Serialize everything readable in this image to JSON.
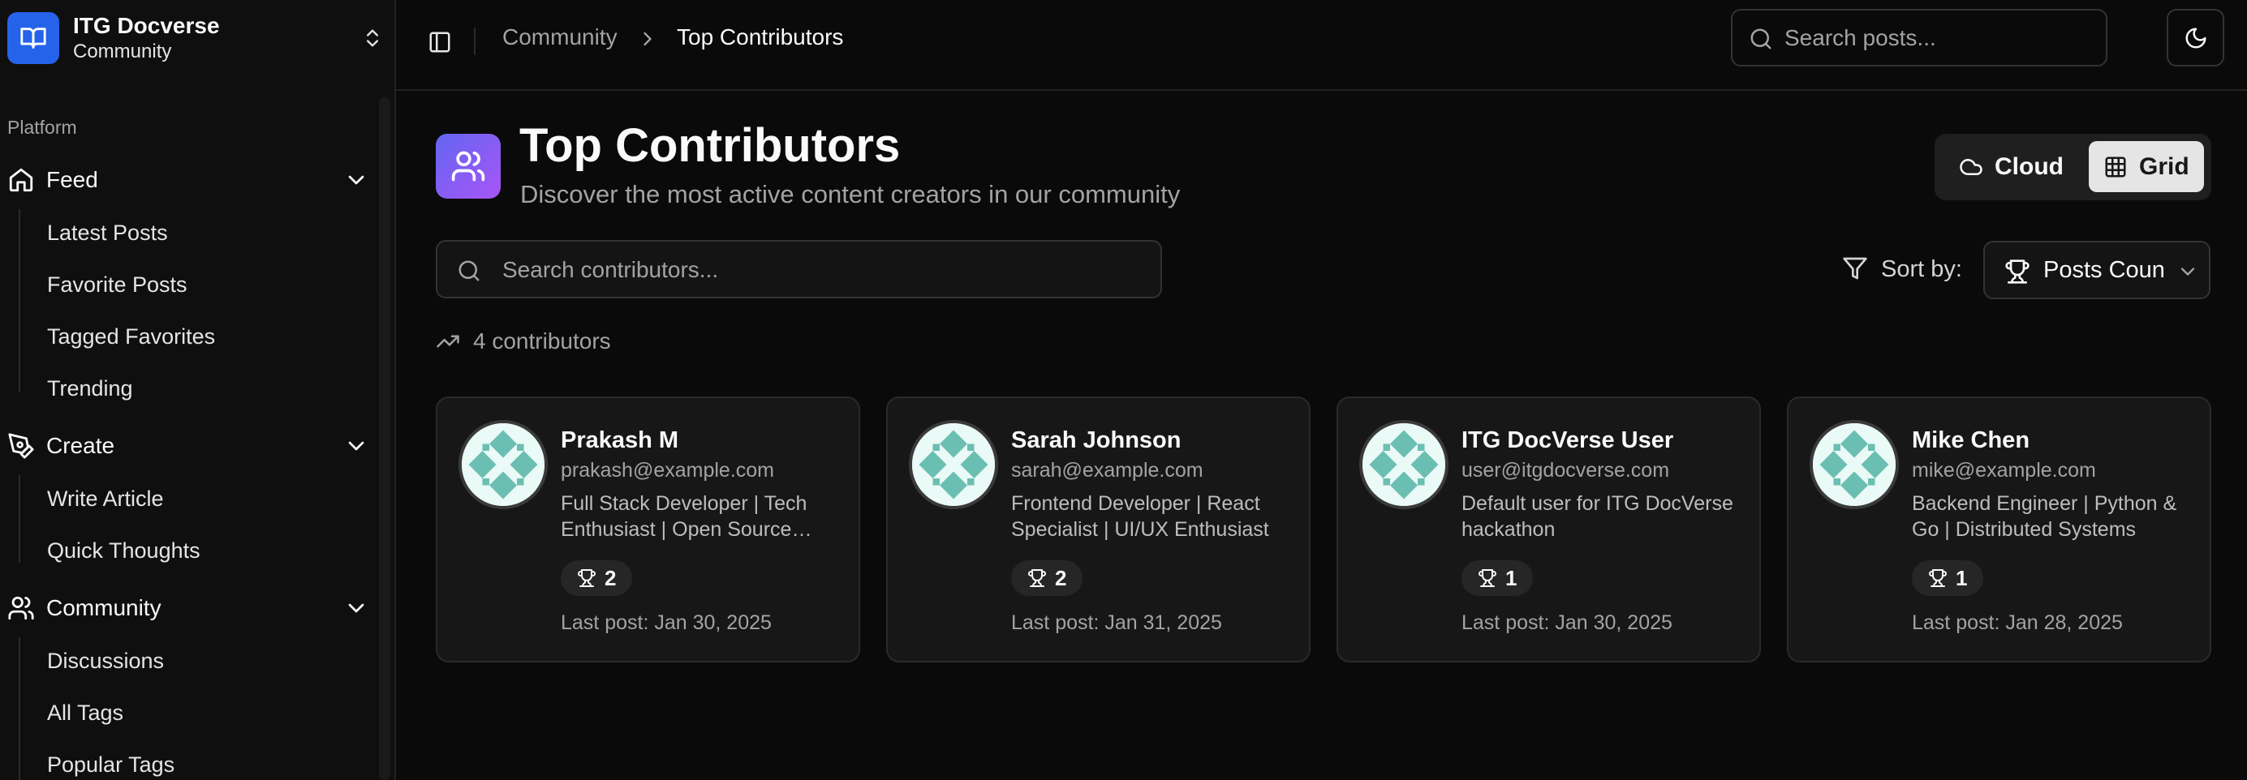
{
  "sidebar": {
    "brand": {
      "title": "ITG Docverse",
      "subtitle": "Community"
    },
    "section_label": "Platform",
    "groups": [
      {
        "label": "Feed",
        "icon": "home-icon",
        "items": [
          "Latest Posts",
          "Favorite Posts",
          "Tagged Favorites",
          "Trending"
        ]
      },
      {
        "label": "Create",
        "icon": "pen-tool-icon",
        "items": [
          "Write Article",
          "Quick Thoughts"
        ]
      },
      {
        "label": "Community",
        "icon": "users-icon",
        "items": [
          "Discussions",
          "All Tags",
          "Popular Tags"
        ]
      }
    ]
  },
  "header": {
    "breadcrumb": [
      "Community",
      "Top Contributors"
    ],
    "search_placeholder": "Search posts..."
  },
  "main": {
    "title": "Top Contributors",
    "subtitle": "Discover the most active content creators in our community",
    "view_toggle": {
      "cloud": "Cloud",
      "grid": "Grid",
      "active": "grid"
    },
    "search_placeholder": "Search contributors...",
    "sort_label": "Sort by:",
    "sort_value": "Posts Count",
    "count_text": "4 contributors"
  },
  "contributors": [
    {
      "name": "Prakash M",
      "email": "prakash@example.com",
      "bio": "Full Stack Developer | Tech Enthusiast | Open Source Contributor",
      "posts": "2",
      "last_post": "Last post: Jan 30, 2025"
    },
    {
      "name": "Sarah Johnson",
      "email": "sarah@example.com",
      "bio": "Frontend Developer | React Specialist | UI/UX Enthusiast",
      "posts": "2",
      "last_post": "Last post: Jan 31, 2025"
    },
    {
      "name": "ITG DocVerse User",
      "email": "user@itgdocverse.com",
      "bio": "Default user for ITG DocVerse hackathon",
      "posts": "1",
      "last_post": "Last post: Jan 30, 2025"
    },
    {
      "name": "Mike Chen",
      "email": "mike@example.com",
      "bio": "Backend Engineer | Python & Go | Distributed Systems",
      "posts": "1",
      "last_post": "Last post: Jan 28, 2025"
    }
  ],
  "colors": {
    "brand": "#2563eb",
    "avatar_teal": "#6bbfb2",
    "background": "#0a0a0a"
  }
}
